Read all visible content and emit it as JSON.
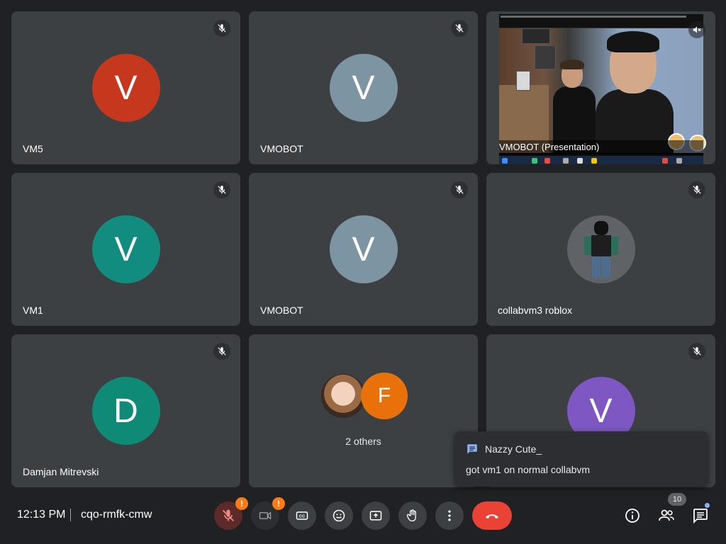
{
  "colors": {
    "background": "#202124",
    "tile": "#3c4043",
    "hangup": "#ea4335",
    "warning": "#fa7b17",
    "accent_dot": "#8ab4f8"
  },
  "tiles": [
    {
      "name": "VM5",
      "initial": "V",
      "avatar_color": "#c5381e",
      "muted": true
    },
    {
      "name": "VMOBOT",
      "initial": "V",
      "avatar_color": "#7d95a2",
      "muted": true
    },
    {
      "name": "VMOBOT (Presentation)",
      "muted": true,
      "type": "presentation"
    },
    {
      "name": "VM1",
      "initial": "V",
      "avatar_color": "#128c7e",
      "muted": true
    },
    {
      "name": "VMOBOT",
      "initial": "V",
      "avatar_color": "#7d95a2",
      "muted": true
    },
    {
      "name": "collabvm3 roblox",
      "muted": true,
      "type": "image-avatar"
    },
    {
      "name": "Damjan Mitrevski",
      "initial": "D",
      "avatar_color": "#0e8a76",
      "muted": true
    },
    {
      "name": "2 others",
      "type": "group",
      "second_initial": "F",
      "second_color": "#e8710a"
    },
    {
      "name": "",
      "initial": "V",
      "avatar_color": "#7e57c2",
      "muted": true
    }
  ],
  "chat_toast": {
    "sender": "Nazzy Cute_",
    "message": "got vm1 on normal collabvm",
    "icon": "chat-icon"
  },
  "bottom_bar": {
    "time": "12:13 PM",
    "meeting_code": "cqo-rmfk-cmw",
    "mic_warning": "!",
    "camera_warning": "!",
    "people_count": "10"
  }
}
